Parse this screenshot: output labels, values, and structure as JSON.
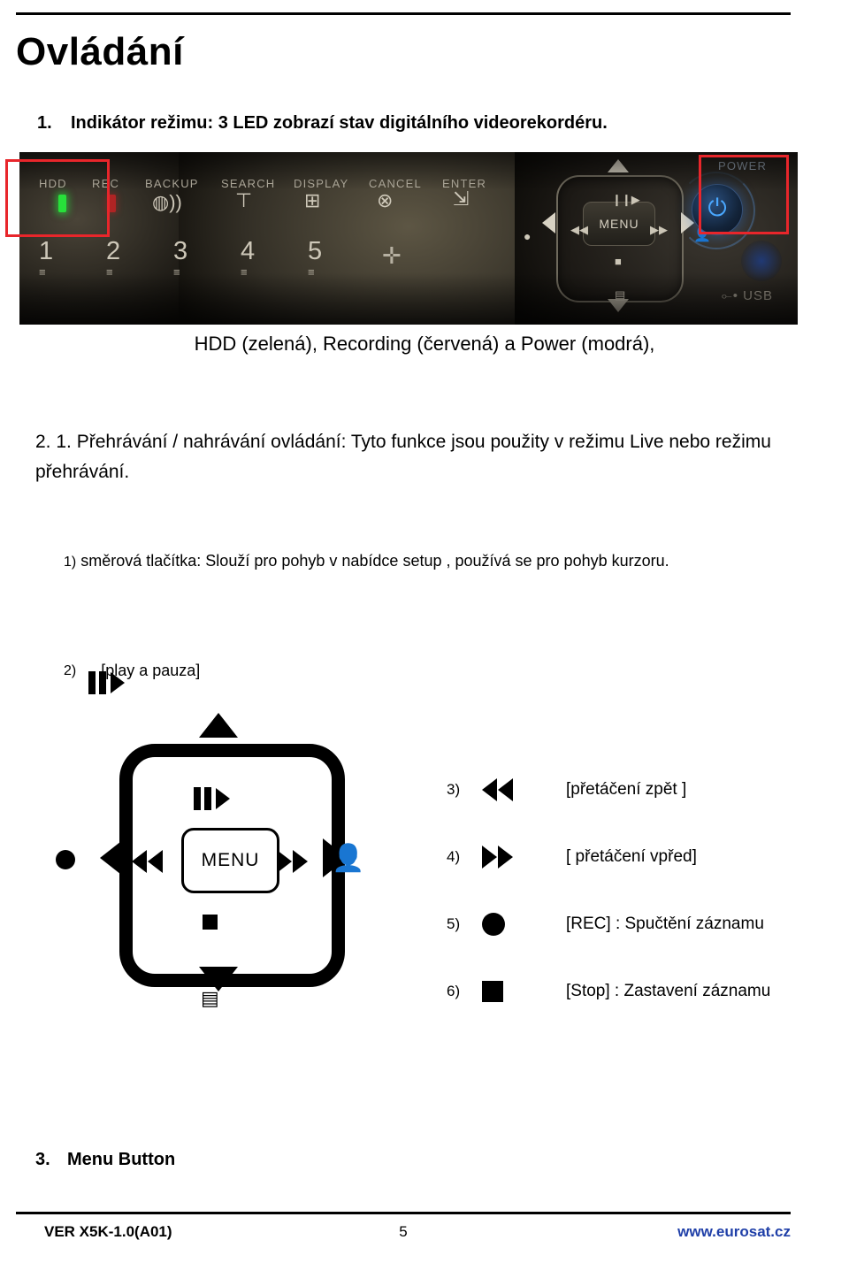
{
  "document": {
    "title": "Ovládání",
    "items": [
      {
        "number": "1.",
        "text": "Indikátor režimu: 3 LED zobrazí stav digitálního videorekordéru."
      },
      {
        "number": "2.  1.",
        "text": "Přehrávání / nahrávání ovládání: Tyto funkce jsou použity v režimu Live",
        "text_tail": "nebo režimu přehrávání."
      },
      {
        "number": "3.",
        "text": "Menu Button"
      }
    ],
    "caption": "HDD (zelená), Recording (červená) a Power (modrá),",
    "sub_items": [
      {
        "number": "1)",
        "text": "směrová tlačítka: Slouží pro pohyb v nabídce setup ,  používá se pro pohyb kurzoru."
      },
      {
        "number": "2)",
        "icon": "play-pause-icon",
        "text": "[play a pauza]"
      },
      {
        "number": "3)",
        "icon": "rewind-icon",
        "text": "[přetáčení zpět ]"
      },
      {
        "number": "4)",
        "icon": "fast-forward-icon",
        "text": "[ přetáčení vpřed]"
      },
      {
        "number": "5)",
        "icon": "record-circle-icon",
        "text": "[REC] : Spučtění záznamu"
      },
      {
        "number": "6)",
        "icon": "stop-square-icon",
        "text": "[Stop] : Zastavení záznamu"
      }
    ]
  },
  "panel": {
    "labels": [
      {
        "text": "HDD"
      },
      {
        "text": "REC"
      },
      {
        "text": "BACKUP"
      },
      {
        "text": "SEARCH"
      },
      {
        "text": "DISPLAY"
      },
      {
        "text": "CANCEL"
      },
      {
        "text": "ENTER"
      },
      {
        "text": "POWER"
      }
    ],
    "numbers": [
      "1",
      "2",
      "3",
      "4",
      "5"
    ],
    "menu_label": "MENU",
    "usb_label": "USB",
    "highlight_color": "#e8262b",
    "led_green": "#27e03a",
    "led_red": "#b02424",
    "power_blue": "#4aa8ff"
  },
  "diagram": {
    "menu_label": "MENU",
    "up_icon": "triangle-up-icon",
    "down_icon": "triangle-down-icon",
    "left_icon": "triangle-left-icon",
    "right_icon": "triangle-right-icon",
    "play_pause_icon": "play-pause-icon",
    "rewind_icon": "rewind-icon",
    "forward_icon": "fast-forward-icon",
    "record_icon": "record-circle-icon",
    "stop_icon": "stop-square-icon",
    "person_icon": "person-icon",
    "list_icon": "list-icon"
  },
  "footer": {
    "left": "VER X5K-1.0(A01)",
    "page": "5",
    "right": "www.eurosat.cz",
    "link_color": "#1f3fa8"
  }
}
